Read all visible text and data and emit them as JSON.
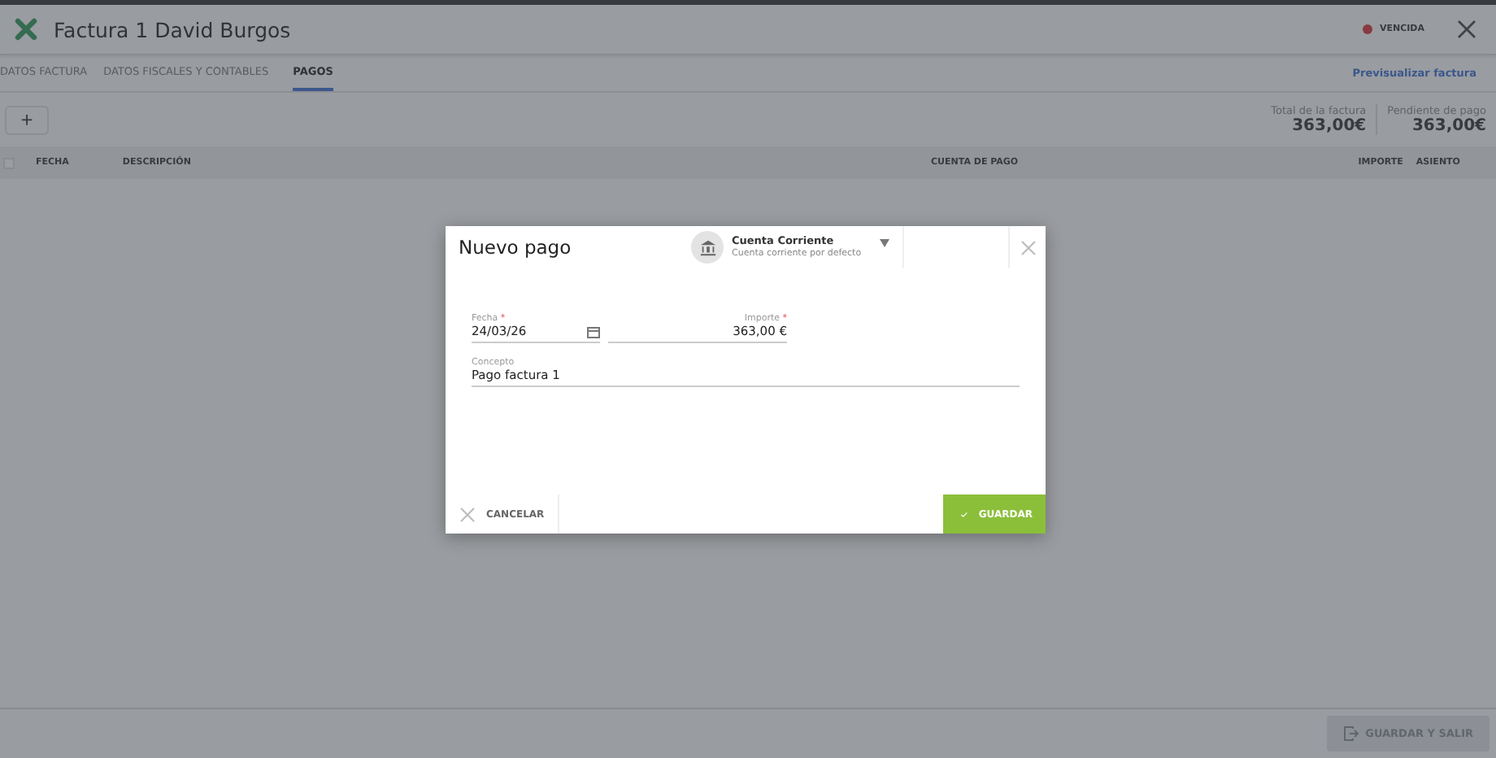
{
  "window": {
    "title": "Factura 1 David Burgos",
    "status": "VENCIDA"
  },
  "tabs": [
    {
      "label": "DATOS FACTURA",
      "selected": false
    },
    {
      "label": "DATOS FISCALES Y CONTABLES",
      "selected": false
    },
    {
      "label": "PAGOS",
      "selected": true
    }
  ],
  "preview_link": "Previsualizar factura",
  "add_button": "+",
  "totals": [
    {
      "label": "Total de la factura",
      "value": "363,00€"
    },
    {
      "label": "Pendiente de pago",
      "value": "363,00€"
    }
  ],
  "table": {
    "select_all_checked": false,
    "columns": [
      "FECHA",
      "DESCRIPCIÓN",
      "CUENTA DE PAGO",
      "IMPORTE",
      "ASIENTO"
    ]
  },
  "footer": {
    "save_exit": "GUARDAR Y SALIR",
    "save_exit_disabled": true
  },
  "dialog": {
    "title": "Nuevo pago",
    "account": {
      "name": "Cuenta Corriente",
      "detail": "Cuenta corriente por defecto"
    },
    "fields": [
      {
        "label": "Fecha",
        "required_mark": "*",
        "value": "24/03/26",
        "kind": "date"
      },
      {
        "label": "Importe",
        "required_mark": "*",
        "value": "363,00 €",
        "kind": "amount"
      },
      {
        "label": "Concepto",
        "value": "Pago factura 1",
        "kind": "text"
      }
    ],
    "cancel": "CANCELAR",
    "save": "GUARDAR"
  }
}
